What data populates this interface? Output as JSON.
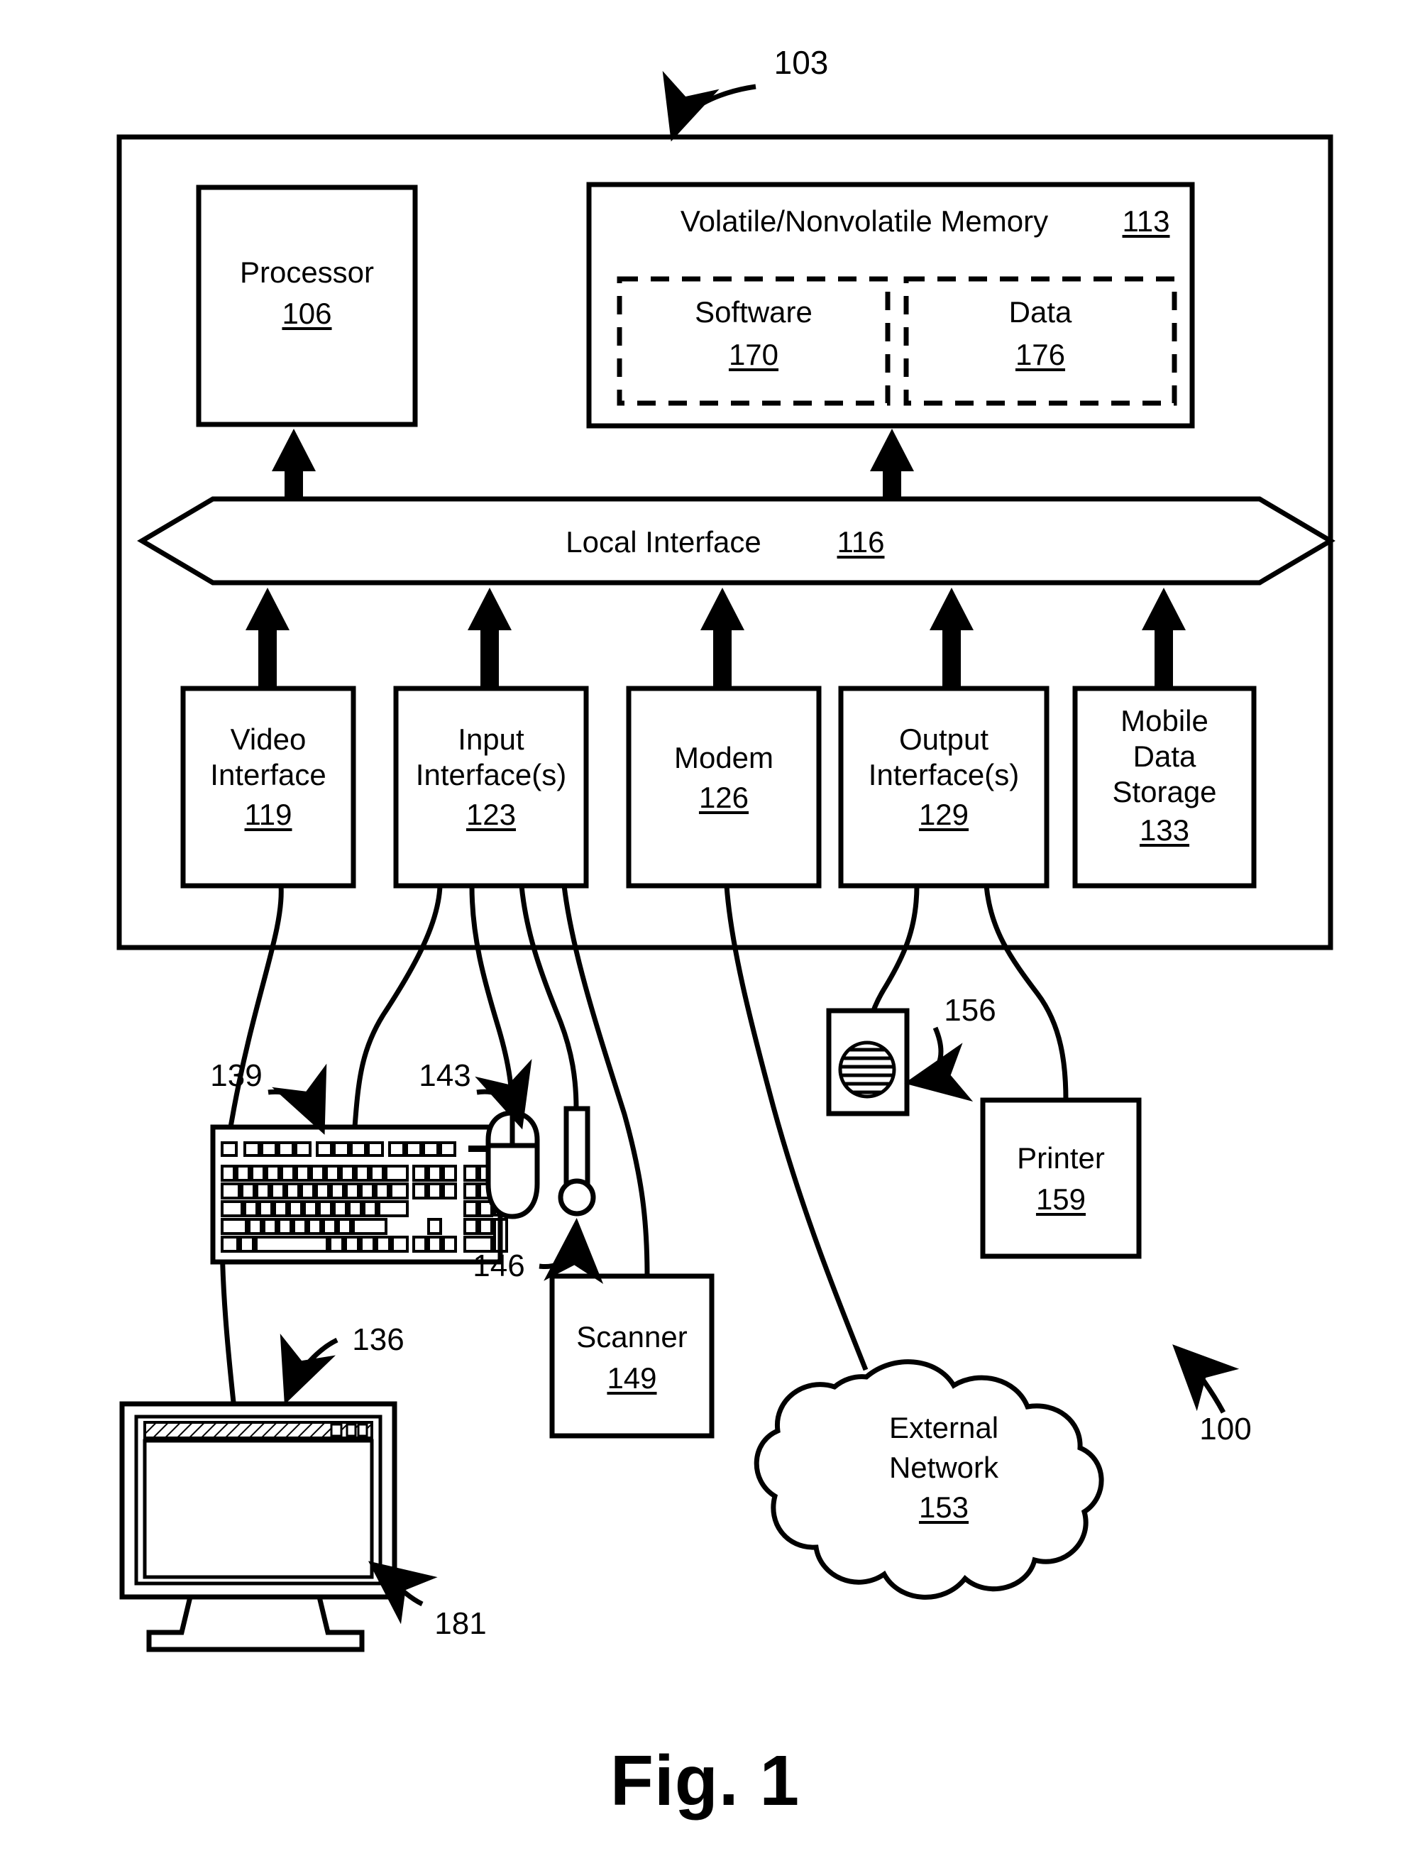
{
  "figure": {
    "caption": "Fig. 1",
    "system_ref": "100",
    "computer_ref": "103"
  },
  "blocks": {
    "processor": {
      "label": "Processor",
      "ref": "106"
    },
    "memory": {
      "label": "Volatile/Nonvolatile Memory",
      "ref": "113"
    },
    "software": {
      "label": "Software",
      "ref": "170"
    },
    "data": {
      "label": "Data",
      "ref": "176"
    },
    "local_interface": {
      "label": "Local Interface",
      "ref": "116"
    },
    "video_interface": {
      "line1": "Video",
      "line2": "Interface",
      "ref": "119"
    },
    "input_interface": {
      "line1": "Input",
      "line2": "Interface(s)",
      "ref": "123"
    },
    "modem": {
      "line1": "Modem",
      "line2": "",
      "ref": "126"
    },
    "output_interface": {
      "line1": "Output",
      "line2": "Interface(s)",
      "ref": "129"
    },
    "mobile_data_storage": {
      "line1": "Mobile",
      "line2": "Data",
      "line3": "Storage",
      "ref": "133"
    },
    "scanner": {
      "label": "Scanner",
      "ref": "149"
    },
    "external_network": {
      "line1": "External",
      "line2": "Network",
      "ref": "153"
    },
    "printer": {
      "label": "Printer",
      "ref": "159"
    }
  },
  "peripherals": {
    "monitor": {
      "ref": "136",
      "screen_ref": "181"
    },
    "keyboard": {
      "ref": "139"
    },
    "mouse": {
      "ref": "143"
    },
    "microphone": {
      "ref": "146"
    },
    "speaker": {
      "ref": "156"
    }
  },
  "colors": {
    "ink": "#000000",
    "paper": "#ffffff"
  }
}
